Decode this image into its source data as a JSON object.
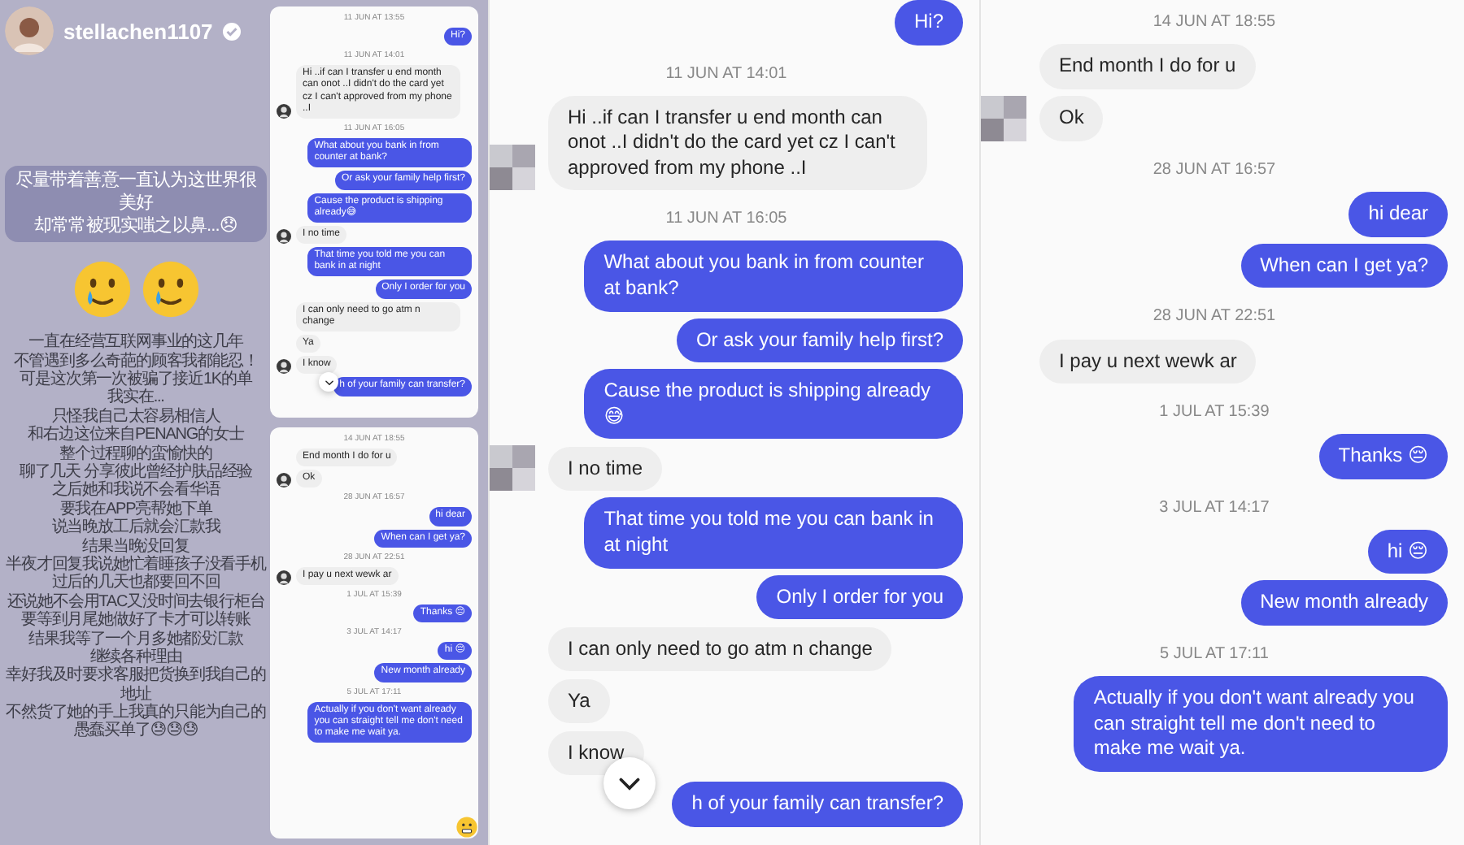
{
  "story": {
    "username": "stellachen1107",
    "verified": true,
    "headline": [
      "尽量带着善意一直认为这世界很美好",
      "却常常被现实嗤之以鼻...😞"
    ],
    "body": [
      "一直在经营互联网事业的这几年",
      "不管遇到多么奇葩的顾客我都能忍！",
      "可是这次第一次被骗了接近1K的单",
      "我实在...",
      "只怪我自己太容易相信人",
      "和右边这位来自PENANG的女士",
      "整个过程聊的蛮愉快的",
      "聊了几天 分享彼此曾经护肤品经验",
      "之后她和我说不会看华语",
      "要我在APP亮帮她下单",
      "说当晚放工后就会汇款我",
      "结果当晚没回复",
      "半夜才回复我说她忙着睡孩子没看手机",
      "过后的几天也都要回不回",
      "还说她不会用TAC又没时间去银行柜台",
      "要等到月尾她做好了卡才可以转账",
      "结果我等了一个月多她都没汇款",
      "继续各种理由",
      "幸好我及时要求客服把货换到我自己的",
      "地址",
      "不然货了她的手上我真的只能为自己的",
      "愚蠢买单了😓😓😓"
    ]
  },
  "thumbnails": [
    {
      "messages": [
        {
          "kind": "time",
          "text": "11 JUN AT 13:55"
        },
        {
          "kind": "sent",
          "text": "Hi?"
        },
        {
          "kind": "time",
          "text": "11 JUN AT 14:01"
        },
        {
          "kind": "received",
          "avatar": true,
          "text": "Hi ..if can I transfer u end month can onot ..I didn't do the card yet cz I can't approved from my phone ..I"
        },
        {
          "kind": "time",
          "text": "11 JUN AT 16:05"
        },
        {
          "kind": "sent",
          "text": "What about you bank in from counter at bank?"
        },
        {
          "kind": "sent",
          "text": "Or ask your family help first?"
        },
        {
          "kind": "sent",
          "text": "Cause the product is shipping already😅"
        },
        {
          "kind": "received",
          "avatar": true,
          "text": "I no time"
        },
        {
          "kind": "sent",
          "text": "That time you told me you can bank in at night"
        },
        {
          "kind": "sent",
          "text": "Only I order for you"
        },
        {
          "kind": "received",
          "avatar": false,
          "text": "I can only need to go atm n change"
        },
        {
          "kind": "received",
          "avatar": false,
          "text": "Ya"
        },
        {
          "kind": "received",
          "avatar": true,
          "text": "I know"
        },
        {
          "kind": "sent",
          "text": "h of your family can transfer?"
        }
      ],
      "scroll_button": true
    },
    {
      "messages": [
        {
          "kind": "time",
          "text": "14 JUN AT 18:55"
        },
        {
          "kind": "received",
          "avatar": false,
          "text": "End month I do for u"
        },
        {
          "kind": "received",
          "avatar": true,
          "text": "Ok"
        },
        {
          "kind": "time",
          "text": "28 JUN AT 16:57"
        },
        {
          "kind": "sent",
          "text": "hi dear"
        },
        {
          "kind": "sent",
          "text": "When can I get ya?"
        },
        {
          "kind": "time",
          "text": "28 JUN AT 22:51"
        },
        {
          "kind": "received",
          "avatar": true,
          "text": "I pay u next wewk ar"
        },
        {
          "kind": "time",
          "text": "1 JUL AT 15:39"
        },
        {
          "kind": "sent",
          "text": "Thanks 😔"
        },
        {
          "kind": "time",
          "text": "3 JUL AT 14:17"
        },
        {
          "kind": "sent",
          "text": "hi 😔"
        },
        {
          "kind": "sent",
          "text": "New month already"
        },
        {
          "kind": "time",
          "text": "5 JUL AT 17:11"
        },
        {
          "kind": "sent",
          "text": "Actually if you don't want already you can straight tell me don't need to make me wait ya."
        }
      ],
      "scroll_button": false
    }
  ],
  "chats": [
    {
      "messages": [
        {
          "kind": "sent",
          "text": "Hi?"
        },
        {
          "kind": "time",
          "text": "11 JUN AT 14:01"
        },
        {
          "kind": "received",
          "avatar": true,
          "text": "Hi ..if can I transfer u end month can onot ..I didn't do the card yet cz I can't approved from my phone ..I"
        },
        {
          "kind": "time",
          "text": "11 JUN AT 16:05"
        },
        {
          "kind": "sent",
          "text": "What about you bank in from counter at bank?"
        },
        {
          "kind": "sent",
          "text": "Or ask your family help first?"
        },
        {
          "kind": "sent",
          "text": "Cause the product is shipping already😅"
        },
        {
          "kind": "received",
          "avatar": true,
          "text": "I no time"
        },
        {
          "kind": "sent",
          "text": "That time you told me you can bank in at night"
        },
        {
          "kind": "sent",
          "text": "Only I order for you"
        },
        {
          "kind": "received",
          "avatar": false,
          "text": "I can only need to go atm n change"
        },
        {
          "kind": "received",
          "avatar": false,
          "text": "Ya"
        },
        {
          "kind": "received",
          "avatar": false,
          "text": "I know"
        },
        {
          "kind": "sent",
          "text": "h of your family can transfer?"
        }
      ],
      "scroll_button": true
    },
    {
      "messages": [
        {
          "kind": "time",
          "text": "14 JUN AT 18:55"
        },
        {
          "kind": "received",
          "avatar": false,
          "text": "End month I do for u"
        },
        {
          "kind": "received",
          "avatar": true,
          "text": "Ok"
        },
        {
          "kind": "time",
          "text": "28 JUN AT 16:57"
        },
        {
          "kind": "sent",
          "text": "hi dear"
        },
        {
          "kind": "sent",
          "text": "When can I get ya?"
        },
        {
          "kind": "time",
          "text": "28 JUN AT 22:51"
        },
        {
          "kind": "received",
          "avatar": false,
          "text": "I pay u next wewk ar"
        },
        {
          "kind": "time",
          "text": "1 JUL AT 15:39"
        },
        {
          "kind": "sent",
          "text": "Thanks 😔"
        },
        {
          "kind": "time",
          "text": "3 JUL AT 14:17"
        },
        {
          "kind": "sent",
          "text": "hi 😔"
        },
        {
          "kind": "sent",
          "text": "New month already"
        },
        {
          "kind": "time",
          "text": "5 JUL AT 17:11"
        },
        {
          "kind": "sent",
          "text": "Actually if you don't want already you can straight tell me don't need to make me wait ya."
        }
      ],
      "scroll_button": false
    }
  ]
}
